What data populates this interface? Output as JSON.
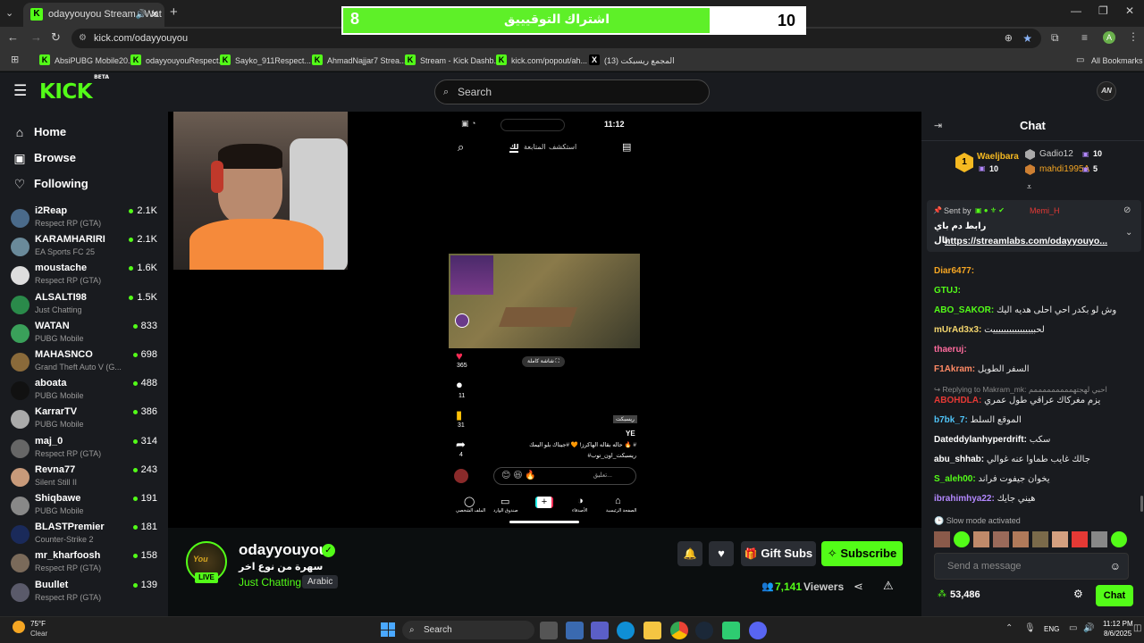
{
  "browser": {
    "tab_title": "odayyouyou Stream - Wat",
    "url": "kick.com/odayyouyou",
    "bookmarks": [
      "AbsiPUBG Mobile20...",
      "odayyouyouRespect...",
      "Sayko_911Respect...",
      "AhmadNajjar7 Strea...",
      "Stream - Kick Dashb...",
      "kick.com/popout/ah...",
      "(13) المجمع ريسبكت"
    ],
    "all_bookmarks": "All Bookmarks"
  },
  "overlay": {
    "left_number": "8",
    "text": "اشتراك التوقيييق",
    "right_number": "10"
  },
  "header": {
    "logo": "KICK",
    "beta": "BETA",
    "search_placeholder": "Search",
    "avatar_initials": "AN"
  },
  "sidebar": {
    "nav": [
      {
        "label": "Home",
        "icon": "home-icon"
      },
      {
        "label": "Browse",
        "icon": "browse-icon"
      },
      {
        "label": "Following",
        "icon": "heart-icon"
      }
    ],
    "channels": [
      {
        "name": "i2Reap",
        "category": "Respect RP (GTA)",
        "viewers": "2.1K",
        "color": "#4a6a8a"
      },
      {
        "name": "KARAMHARIRI",
        "category": "EA Sports FC 25",
        "viewers": "2.1K",
        "color": "#6a8a9a"
      },
      {
        "name": "moustache",
        "category": "Respect RP (GTA)",
        "viewers": "1.6K",
        "color": "#ddd"
      },
      {
        "name": "ALSALTI98",
        "category": "Just Chatting",
        "viewers": "1.5K",
        "color": "#2a8a4a"
      },
      {
        "name": "WATAN",
        "category": "PUBG Mobile",
        "viewers": "833",
        "color": "#3aa05a"
      },
      {
        "name": "MAHASNCO",
        "category": "Grand Theft Auto V (G...",
        "viewers": "698",
        "color": "#8a6a3a"
      },
      {
        "name": "aboata",
        "category": "PUBG Mobile",
        "viewers": "488",
        "color": "#111"
      },
      {
        "name": "KarrarTV",
        "category": "PUBG Mobile",
        "viewers": "386",
        "color": "#aaa"
      },
      {
        "name": "maj_0",
        "category": "Respect RP (GTA)",
        "viewers": "314",
        "color": "#666"
      },
      {
        "name": "Revna77",
        "category": "Silent Still II",
        "viewers": "243",
        "color": "#c89a7a"
      },
      {
        "name": "Shiqbawe",
        "category": "PUBG Mobile",
        "viewers": "191",
        "color": "#888"
      },
      {
        "name": "BLASTPremier",
        "category": "Counter-Strike 2",
        "viewers": "181",
        "color": "#1a2a5a"
      },
      {
        "name": "mr_kharfoosh",
        "category": "Respect RP (GTA)",
        "viewers": "158",
        "color": "#7a6a5a"
      },
      {
        "name": "Buullet",
        "category": "Respect RP (GTA)",
        "viewers": "139",
        "color": "#5a5a6a"
      }
    ]
  },
  "phone": {
    "time": "11:12",
    "tabs": [
      "استكشف",
      "المتابعة",
      "لك"
    ],
    "likes": "365",
    "comments": "11",
    "saves": "31",
    "shares": "4",
    "caption_tag": "ريسبكت",
    "caption_user": "YE",
    "caption": "حاله بقاله الهاكرز! 🧡 #جيناك بلو اليمك 🔥 #",
    "caption2": "#ريسبكت_اون_توب",
    "comment_placeholder": "تعليق...",
    "subtitle_btn": "شاشة كاملة",
    "nav": [
      "الصفحة الرئيسية",
      "الأصدقاء",
      "",
      "صندوق الوارد",
      "الملف الشخصي"
    ]
  },
  "streamer": {
    "name": "odayyouyou",
    "title": "سهرة من نوع اخر",
    "category": "Just Chatting",
    "language": "Arabic",
    "live": "LIVE",
    "viewers": "7,141",
    "viewers_label": "Viewers",
    "gift_subs": "Gift Subs",
    "subscribe": "Subscribe"
  },
  "chat": {
    "title": "Chat",
    "leaderboard": [
      {
        "rank": "1",
        "name": "Waeljbara",
        "count": "10"
      },
      {
        "name": "Gadio12",
        "count": "10"
      },
      {
        "name": "mahdi1995A",
        "count": "5"
      }
    ],
    "pinned": {
      "sent_by": "Sent by",
      "user": "Memi_H",
      "text": "رابط دم باي",
      "link_prefix": "بال",
      "link": "https://streamlabs.com/odayyouyo..."
    },
    "messages": [
      {
        "user": "Diar6477:",
        "text": "",
        "color": "#f5a623"
      },
      {
        "user": "GTUJ:",
        "text": "",
        "color": "#53fc18"
      },
      {
        "user": "ABO_SAKOR:",
        "text": "وش لو بكدر احي احلى هديه اليك",
        "color": "#53fc18"
      },
      {
        "user": "mUrAd3x3:",
        "text": "لحبيييييييييييييييت",
        "color": "#f5d76e"
      },
      {
        "user": "thaeruj:",
        "text": "",
        "color": "#ff6b9d"
      },
      {
        "user": "F1Akram:",
        "text": "السفر الطويل",
        "color": "#ff8a65"
      },
      {
        "user": "ABOHDLA:",
        "text": "يزم مغركاك عراقي طول عمري",
        "color": "#e53935"
      },
      {
        "user": "b7bk_7:",
        "text": "الموقع السلط",
        "color": "#4fc3f7"
      },
      {
        "user": "Dateddylanhyperdrift:",
        "text": "سكب",
        "color": "#ffffff"
      },
      {
        "user": "abu_shhab:",
        "text": "جالك غايب طماوا عنه غوالي",
        "color": "#ffffff"
      },
      {
        "user": "S_aleh00:",
        "text": "يخوان جيفوت فراند",
        "color": "#53fc18"
      },
      {
        "user": "ibrahimhya22:",
        "text": "هيني جايك",
        "color": "#b388ff"
      }
    ],
    "reply_label": "Replying to Makram_mk:",
    "reply_text": "احبي لهجتهمممممممممم",
    "slow_mode": "Slow mode activated",
    "input_placeholder": "Send a message",
    "points": "53,486",
    "chat_button": "Chat"
  },
  "taskbar": {
    "weather_temp": "75°F",
    "weather_desc": "Clear",
    "search": "Search",
    "lang": "ENG",
    "time": "11:12 PM",
    "date": "8/6/2025"
  },
  "colors": {
    "kick_green": "#53fc18",
    "bg_dark": "#0b0e0f",
    "panel": "#191b1f"
  }
}
